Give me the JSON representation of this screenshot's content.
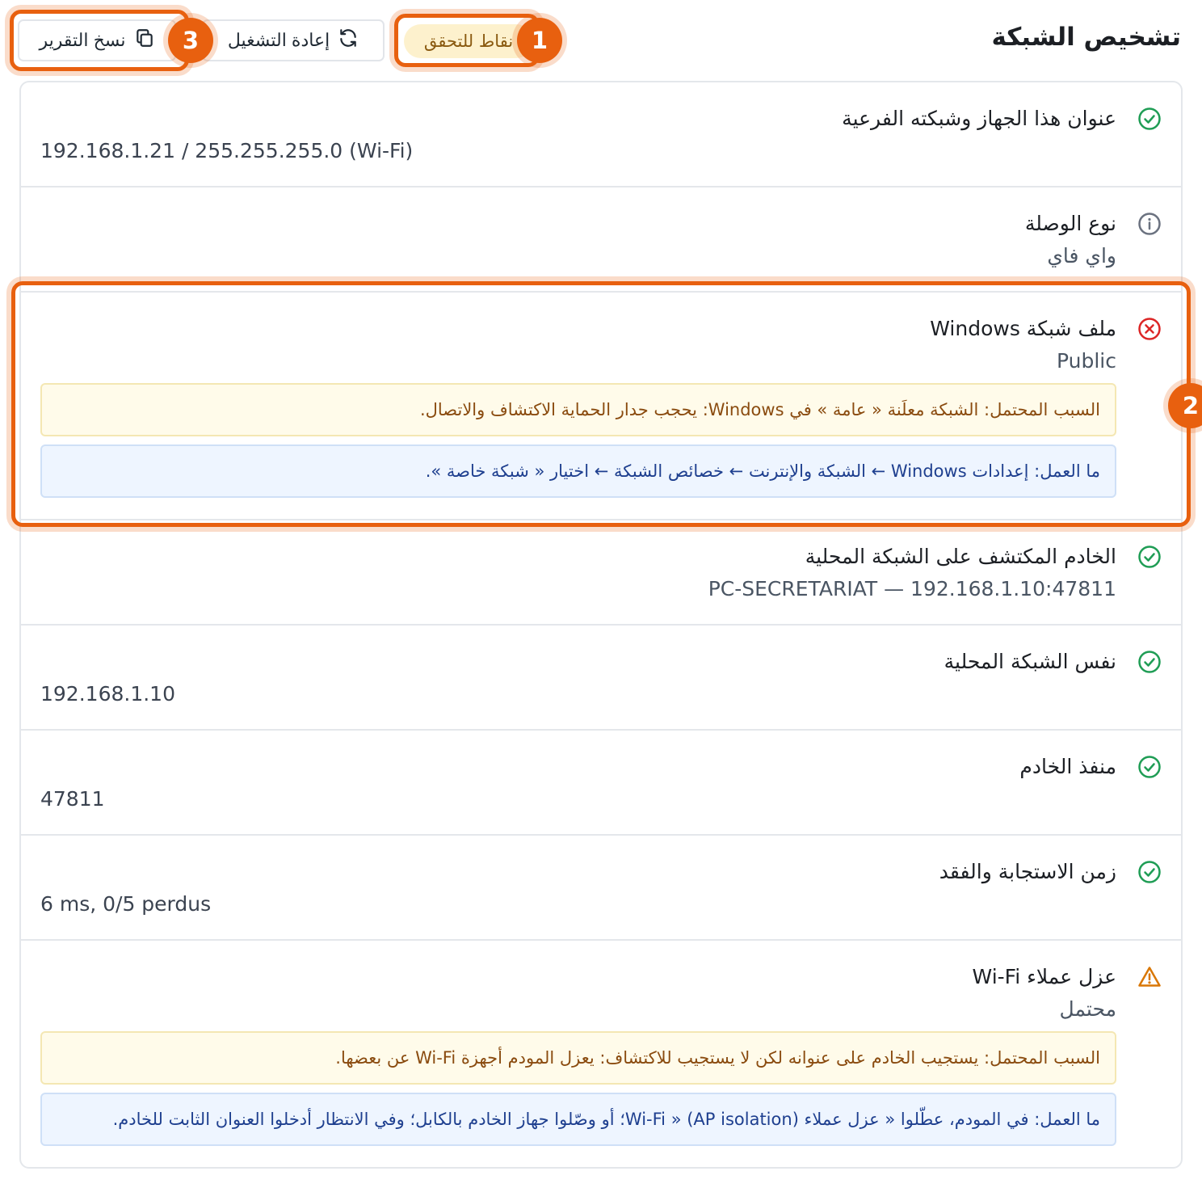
{
  "header": {
    "title": "تشخيص الشبكة",
    "checkpoints_badge": "نقاط للتحقق",
    "restart_label": "إعادة التشغيل",
    "copy_label": "نسخ التقرير"
  },
  "checks": [
    {
      "title": "عنوان هذا الجهاز وشبكته الفرعية",
      "value": "192.168.1.21 / 255.255.255.0 (Wi-Fi)",
      "status": "ok"
    },
    {
      "title": "نوع الوصلة",
      "value": "واي فاي",
      "status": "info"
    },
    {
      "title": "ملف شبكة Windows",
      "value": "Public",
      "status": "error",
      "cause": "السبب المحتمل: الشبكة معلَنة « عامة » في Windows: يحجب جدار الحماية الاكتشاف والاتصال.",
      "action": "ما العمل: إعدادات Windows ← الشبكة والإنترنت ← خصائص الشبكة ← اختيار « شبكة خاصة »."
    },
    {
      "title": "الخادم المكتشف على الشبكة المحلية",
      "value": "PC-SECRETARIAT — 192.168.1.10:47811",
      "status": "ok"
    },
    {
      "title": "نفس الشبكة المحلية",
      "value": "192.168.1.10",
      "status": "ok"
    },
    {
      "title": "منفذ الخادم",
      "value": "47811",
      "status": "ok"
    },
    {
      "title": "زمن الاستجابة والفقد",
      "value": "6 ms, 0/5 perdus",
      "status": "ok"
    },
    {
      "title": "عزل عملاء Wi-Fi",
      "value": "محتمل",
      "status": "warning",
      "cause": "السبب المحتمل: يستجيب الخادم على عنوانه لكن لا يستجيب للاكتشاف: يعزل المودم أجهزة Wi-Fi عن بعضها.",
      "action": "ما العمل: في المودم، عطّلوا « عزل عملاء (AP isolation) « Wi-Fi؛ أو وصّلوا جهاز الخادم بالكابل؛ وفي الانتظار أدخلوا العنوان الثابت للخادم."
    }
  ],
  "annotations": {
    "marker_1": "1",
    "marker_2": "2",
    "marker_3": "3"
  },
  "colors": {
    "ok": "#1f9d55",
    "info": "#6b7280",
    "error": "#dc2626",
    "warning": "#d97706",
    "highlight": "#e8600f",
    "badge_bg": "#fdf1cd"
  },
  "icons": {
    "ok": "check-circle-icon",
    "info": "info-circle-icon",
    "error": "x-circle-icon",
    "warning": "warning-triangle-icon",
    "restart": "refresh-icon",
    "copy": "copy-icon"
  }
}
